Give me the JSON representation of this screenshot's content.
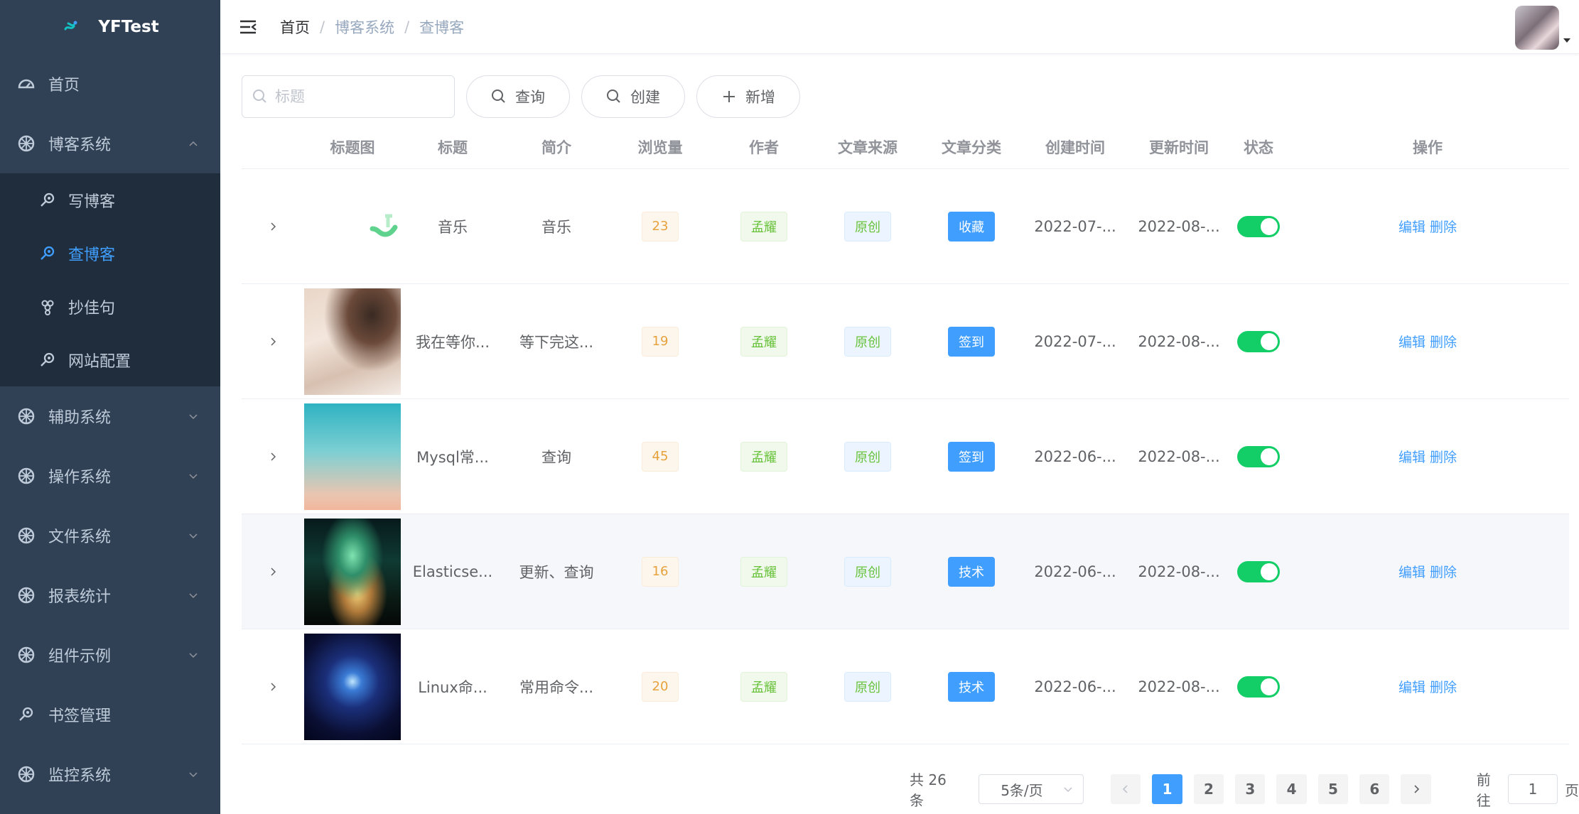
{
  "app": {
    "name": "YFTest"
  },
  "sidebar": {
    "items": [
      {
        "label": "首页",
        "icon": "dashboard-icon"
      },
      {
        "label": "博客系统",
        "icon": "wheel-icon",
        "expanded": true,
        "children": [
          {
            "label": "写博客",
            "icon": "search-key-icon"
          },
          {
            "label": "查博客",
            "icon": "search-key-icon",
            "active": true
          },
          {
            "label": "抄佳句",
            "icon": "grape-icon"
          },
          {
            "label": "网站配置",
            "icon": "search-key-icon"
          }
        ]
      },
      {
        "label": "辅助系统",
        "icon": "wheel-icon"
      },
      {
        "label": "操作系统",
        "icon": "wheel-icon"
      },
      {
        "label": "文件系统",
        "icon": "wheel-icon"
      },
      {
        "label": "报表统计",
        "icon": "wheel-icon"
      },
      {
        "label": "组件示例",
        "icon": "wheel-icon"
      },
      {
        "label": "书签管理",
        "icon": "search-key-icon"
      },
      {
        "label": "监控系统",
        "icon": "wheel-icon"
      }
    ]
  },
  "breadcrumb": {
    "home": "首页",
    "section": "博客系统",
    "current": "查博客"
  },
  "toolbar": {
    "search_placeholder": "标题",
    "query_label": "查询",
    "create_label": "创建",
    "add_label": "新增"
  },
  "table": {
    "columns": [
      "标题图",
      "标题",
      "简介",
      "浏览量",
      "作者",
      "文章来源",
      "文章分类",
      "创建时间",
      "更新时间",
      "状态",
      "操作"
    ],
    "rows": [
      {
        "title": "音乐",
        "intro": "音乐",
        "views": "23",
        "author": "孟耀",
        "source": "原创",
        "category": "收藏",
        "created": "2022-07-...",
        "updated": "2022-08-...",
        "status": true
      },
      {
        "title": "我在等你...",
        "intro": "等下完这...",
        "views": "19",
        "author": "孟耀",
        "source": "原创",
        "category": "签到",
        "created": "2022-07-...",
        "updated": "2022-08-...",
        "status": true
      },
      {
        "title": "Mysql常...",
        "intro": "查询",
        "views": "45",
        "author": "孟耀",
        "source": "原创",
        "category": "签到",
        "created": "2022-06-...",
        "updated": "2022-08-...",
        "status": true
      },
      {
        "title": "Elasticse...",
        "intro": "更新、查询",
        "views": "16",
        "author": "孟耀",
        "source": "原创",
        "category": "技术",
        "created": "2022-06-...",
        "updated": "2022-08-...",
        "status": true
      },
      {
        "title": "Linux命...",
        "intro": "常用命令...",
        "views": "20",
        "author": "孟耀",
        "source": "原创",
        "category": "技术",
        "created": "2022-06-...",
        "updated": "2022-08-...",
        "status": true
      }
    ],
    "edit_label": "编辑",
    "delete_label": "删除"
  },
  "pagination": {
    "total_text": "共 26 条",
    "page_size": "5条/页",
    "pages": [
      "1",
      "2",
      "3",
      "4",
      "5",
      "6"
    ],
    "current_page": "1",
    "goto_label": "前往",
    "goto_value": "1",
    "page_suffix": "页"
  },
  "colors": {
    "sidebar_bg": "#304156",
    "submenu_bg": "#1f2d3d",
    "accent": "#409eff",
    "switch_on": "#13ce66"
  }
}
